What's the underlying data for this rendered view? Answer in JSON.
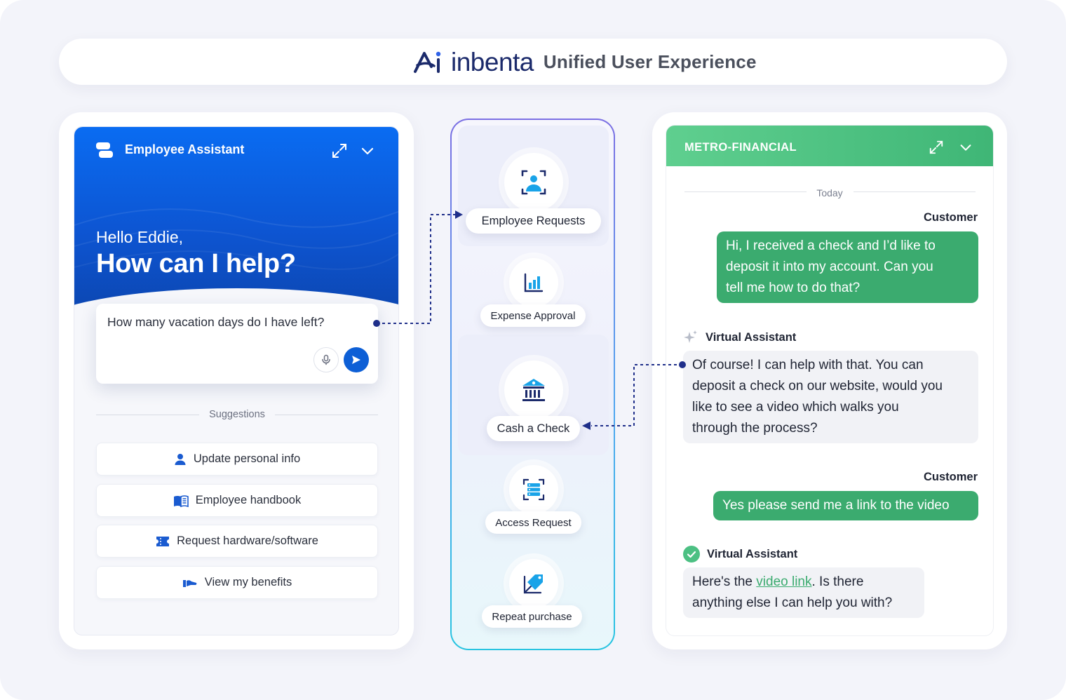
{
  "header": {
    "brand": "inbenta",
    "subtitle": "Unified User Experience"
  },
  "employee_assistant": {
    "title": "Employee Assistant",
    "greeting": "Hello Eddie,",
    "headline": "How can I help?",
    "input_value": "How many vacation days do I have left?",
    "suggestions_label": "Suggestions",
    "suggestions": [
      {
        "label": "Update personal info",
        "icon": "person-icon"
      },
      {
        "label": "Employee handbook",
        "icon": "book-icon"
      },
      {
        "label": "Request hardware/software",
        "icon": "ticket-icon"
      },
      {
        "label": "View my benefits",
        "icon": "benefits-icon"
      }
    ],
    "accent_color": "#0d5fd6"
  },
  "skills": {
    "items": [
      {
        "label": "Employee Requests",
        "icon": "person-scan-icon"
      },
      {
        "label": "Expense Approval",
        "icon": "bar-chart-icon"
      },
      {
        "label": "Cash a Check",
        "icon": "bank-icon"
      },
      {
        "label": "Access Request",
        "icon": "server-scan-icon"
      },
      {
        "label": "Repeat purchase",
        "icon": "price-tag-icon"
      }
    ]
  },
  "metro_financial": {
    "title": "METRO-FINANCIAL",
    "date_divider": "Today",
    "accent_color": "#3bab6f",
    "messages": [
      {
        "author": "Customer",
        "lines": [
          "Hi, I received a check and I’d like to",
          "deposit it into my account. Can you",
          "tell me how to do that?"
        ]
      },
      {
        "author": "Virtual Assistant",
        "lines": [
          "Of course! I can help with that. You can",
          "deposit a check on our website, would you",
          "like to see a video which walks you",
          "through the process?"
        ]
      },
      {
        "author": "Customer",
        "lines": [
          "Yes please send me a link to the video"
        ]
      },
      {
        "author": "Virtual Assistant",
        "pre": "Here's the ",
        "link": "video link",
        "post": ". Is there",
        "line2": "anything else I can help you with?"
      }
    ]
  }
}
